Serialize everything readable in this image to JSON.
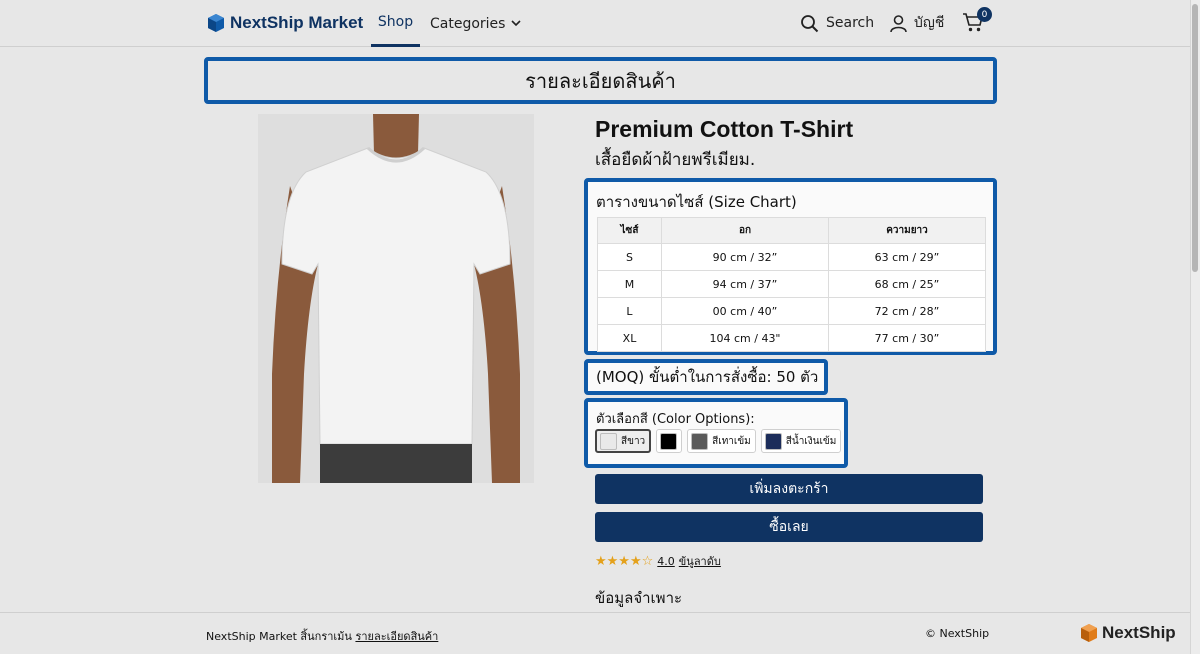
{
  "header": {
    "brand_name": "NextShip Market",
    "nav_shop": "Shop",
    "nav_categories": "Categories",
    "search_label": "Search",
    "account_label": "บัญชี",
    "cart_count": "0"
  },
  "page_heading": "รายละเอียดสินค้า",
  "product": {
    "title": "Premium Cotton T-Shirt",
    "subtitle": "เสื้อยืดผ้าฝ้ายพรีเมียม."
  },
  "size_chart": {
    "title": "ตารางขนาดไซส์ (Size Chart)",
    "headers": [
      "ไซส์",
      "อก",
      "ความยาว"
    ],
    "rows": [
      [
        "S",
        "90 cm / 32”",
        "63 cm / 29”"
      ],
      [
        "M",
        "94 cm / 37”",
        "68 cm / 25”"
      ],
      [
        "L",
        "00 cm / 40”",
        "72 cm / 28”"
      ],
      [
        "XL",
        "104 cm / 43\"",
        "77 cm / 30”"
      ]
    ]
  },
  "moq": "(MOQ) ขั้นต่ำในการสั่งซื้อ: 50 ตัว",
  "colors": {
    "title": "ตัวเลือกสี (Color Options):",
    "options": [
      {
        "label": "สีขาว",
        "color": "#e9e9e9"
      },
      {
        "label": "",
        "color": "#000000"
      },
      {
        "label": "สีเทาเข้ม",
        "color": "#5a5a5a"
      },
      {
        "label": "สีน้ำเงินเข้ม",
        "color": "#1c2d5a"
      }
    ]
  },
  "buttons": {
    "add_to_cart": "เพิ่มลงตะกร้า",
    "buy_now": "ซื้อเลย"
  },
  "rating": {
    "stars": "★★★★☆",
    "value": "4.0",
    "link": "ข้นูลาดับ"
  },
  "spec_title": "ข้อมูลจำเพาะ",
  "footer": {
    "left_text": "NextShip Market สิ้นกราเม้น",
    "left_link": "รายละเอียดสินค้า",
    "copyright": "© NextShip",
    "brand": "NextShip"
  },
  "colors_theme": {
    "primary": "#0f3362",
    "highlight": "#0f5aa8"
  }
}
